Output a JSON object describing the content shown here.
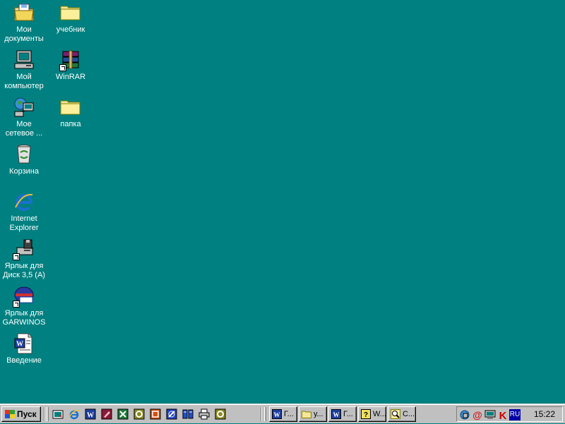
{
  "desktop": {
    "background": "#008080",
    "icons": [
      {
        "label": "Мои\nдокументы",
        "icon": "my-documents-icon"
      },
      {
        "label": "учебник",
        "icon": "folder-icon"
      },
      {
        "label": "Мой\nкомпьютер",
        "icon": "my-computer-icon"
      },
      {
        "label": "WinRAR",
        "icon": "winrar-icon"
      },
      {
        "label": "Мое\nсетевое ...",
        "icon": "network-neighborhood-icon"
      },
      {
        "label": "папка",
        "icon": "folder-icon"
      },
      {
        "label": "Корзина",
        "icon": "recycle-bin-icon"
      },
      {
        "label": "Internet\nExplorer",
        "icon": "internet-explorer-icon"
      },
      {
        "label": "Ярлык для\nДиск 3,5 (A)",
        "icon": "floppy-drive-shortcut-icon"
      },
      {
        "label": "Ярлык для\nGARWINOS",
        "icon": "garwinos-shortcut-icon"
      },
      {
        "label": "Введение",
        "icon": "word-document-icon"
      }
    ]
  },
  "taskbar": {
    "start_label": "Пуск",
    "quick_launch": [
      "show-desktop-icon",
      "internet-explorer-icon",
      "word-icon",
      "access-icon",
      "excel-icon",
      "app-icon",
      "powerpoint-icon",
      "app-icon",
      "app-icon",
      "printer-icon",
      "app-icon"
    ],
    "tasks": [
      {
        "label": "Г...",
        "icon": "word-icon"
      },
      {
        "label": "у...",
        "icon": "folder-icon"
      },
      {
        "label": "Г...",
        "icon": "word-icon"
      },
      {
        "label": "W...",
        "icon": "help-icon"
      },
      {
        "label": "С...",
        "icon": "search-icon"
      }
    ],
    "tray": {
      "icons": [
        "network-icon",
        "mail-icon",
        "monitor-icon",
        "antivirus-icon"
      ],
      "language": "RU",
      "clock": "15:22"
    }
  },
  "colors": {
    "desktop": "#008080",
    "taskbar": "#c0c0c0",
    "folder": "#f6e69a",
    "language_badge": "#0000a8"
  }
}
